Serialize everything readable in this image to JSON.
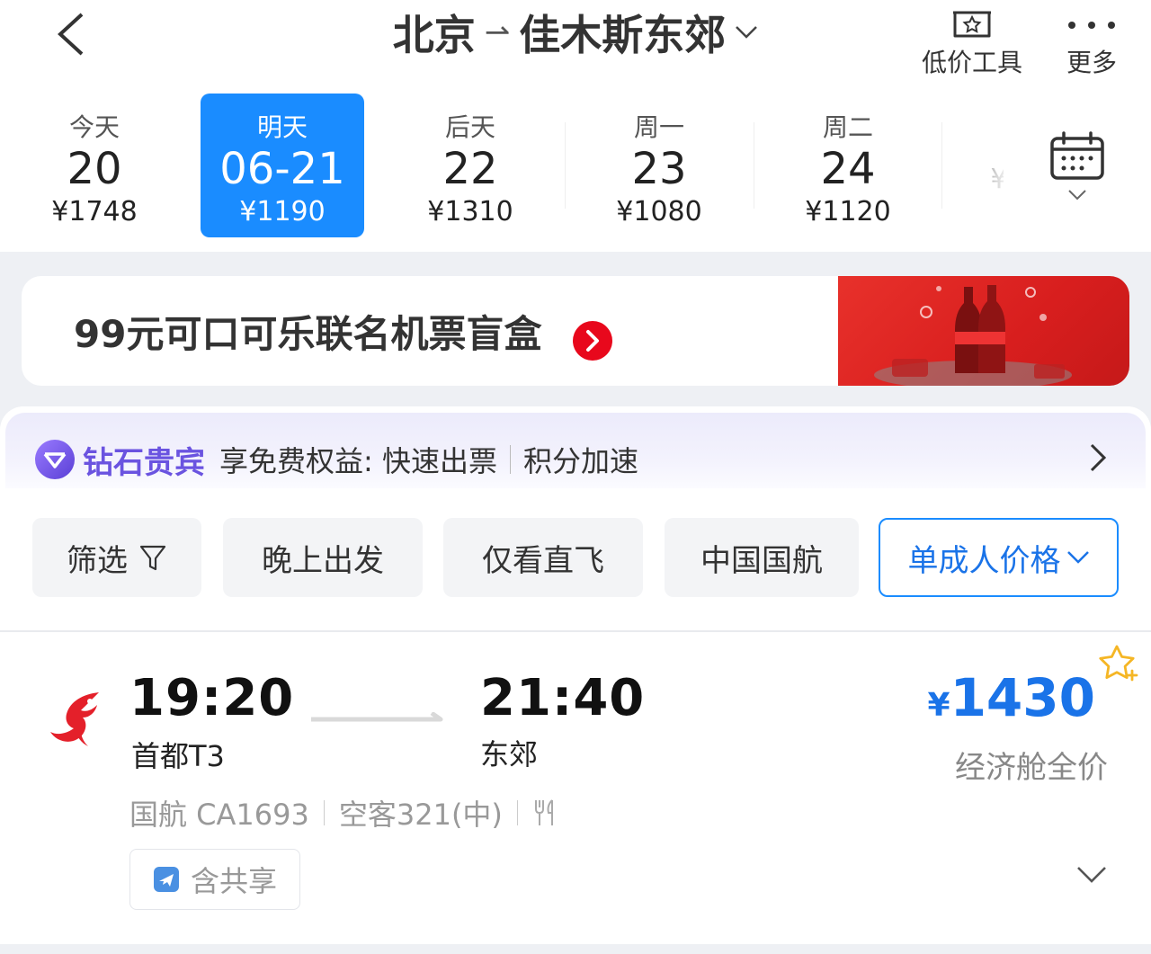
{
  "header": {
    "from": "北京",
    "arrow": "⇀",
    "to": "佳木斯东郊",
    "tools": [
      {
        "label": "低价工具",
        "icon": "basket-star-icon"
      },
      {
        "label": "更多",
        "icon": "more-dots-icon"
      }
    ]
  },
  "dates": [
    {
      "label": "今天",
      "day": "20",
      "price": "¥1748",
      "selected": false
    },
    {
      "label": "明天",
      "day": "06-21",
      "price": "¥1190",
      "selected": true
    },
    {
      "label": "后天",
      "day": "22",
      "price": "¥1310",
      "selected": false
    },
    {
      "label": "周一",
      "day": "23",
      "price": "¥1080",
      "selected": false
    },
    {
      "label": "周二",
      "day": "24",
      "price": "¥1120",
      "selected": false
    },
    {
      "label": "",
      "day": "",
      "price": "¥",
      "selected": false
    }
  ],
  "banner": {
    "text": "99元可口可乐联名机票盲盒"
  },
  "vip": {
    "title": "钻石贵宾",
    "benefit_prefix": "享免费权益: 快速出票",
    "benefit_suffix": "积分加速"
  },
  "filters": [
    {
      "label": "筛选",
      "icon": "filter-funnel-icon"
    },
    {
      "label": "晚上出发"
    },
    {
      "label": "仅看直飞"
    },
    {
      "label": "中国国航"
    },
    {
      "label": "单成人价格",
      "active": true
    }
  ],
  "flight": {
    "dep_time": "19:20",
    "dep_airport": "首都T3",
    "arr_time": "21:40",
    "arr_airport": "东郊",
    "currency": "¥",
    "price": "1430",
    "cabin": "经济舱全价",
    "airline_flight": "国航 CA1693",
    "aircraft": "空客321(中)",
    "share_label": "含共享"
  },
  "colors": {
    "accent": "#1a8cff",
    "price_blue": "#1a73e8",
    "vip_purple": "#6a53e0",
    "airline_red": "#e4202a"
  }
}
